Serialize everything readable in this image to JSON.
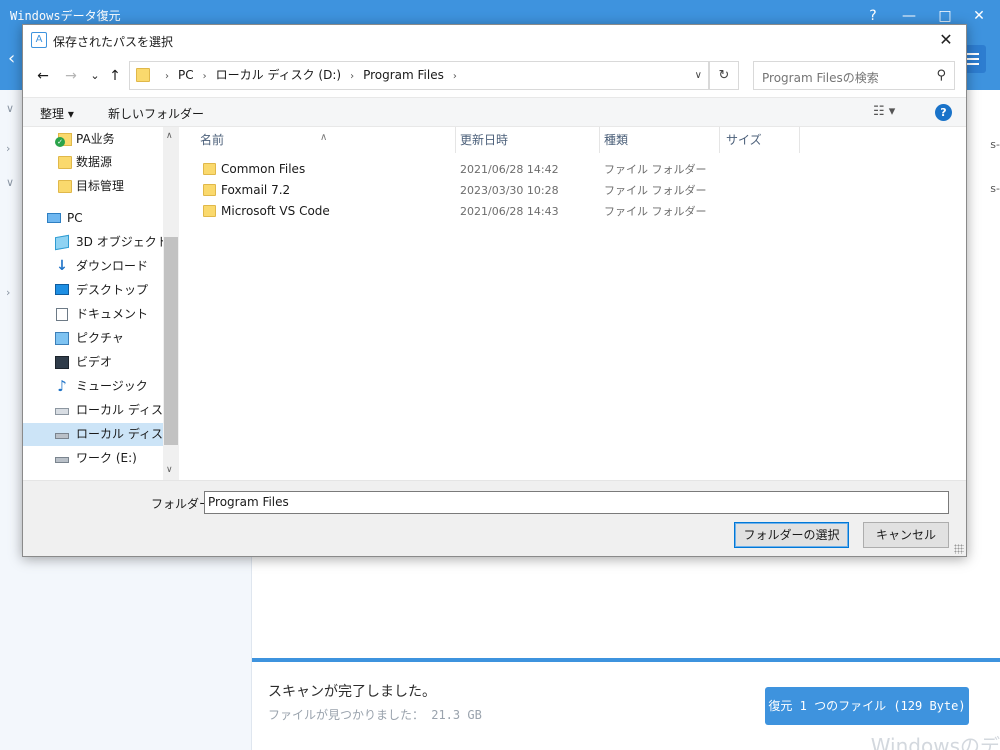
{
  "app": {
    "title": "Windowsデータ復元",
    "controls": {
      "help": "?",
      "minimize": "—",
      "maximize": "□",
      "close": "✕"
    },
    "scan_done": "スキャンが完了しました。",
    "found_text": "ファイルが見つかりました： 21.3 GB",
    "restore_button": "復元 1 つのファイル (129 Byte)",
    "watermark": "Windowsのデ",
    "accent_color": "#3e93de"
  },
  "dialog": {
    "title": "保存されたパスを選択",
    "close": "✕",
    "nav": {
      "back": "←",
      "forward": "→",
      "recent": "⌄",
      "up": "↑"
    },
    "breadcrumbs": [
      "PC",
      "ローカル ディスク (D:)",
      "Program Files"
    ],
    "refresh": "↻",
    "search_placeholder": "Program Filesの検索",
    "toolbar": {
      "organize": "整理 ▾",
      "new_folder": "新しいフォルダー",
      "view": "☷ ▾",
      "help": "?"
    },
    "sidebar": [
      {
        "label": "PA业务",
        "icon": "pa-folder-icon"
      },
      {
        "label": "数据源",
        "icon": "folder-icon"
      },
      {
        "label": "目标管理",
        "icon": "folder-icon"
      },
      {
        "label": "PC",
        "icon": "pc-icon"
      },
      {
        "label": "3D オブジェクト",
        "icon": "3d-objects-icon"
      },
      {
        "label": "ダウンロード",
        "icon": "download-icon"
      },
      {
        "label": "デスクトップ",
        "icon": "desktop-icon"
      },
      {
        "label": "ドキュメント",
        "icon": "document-icon"
      },
      {
        "label": "ピクチャ",
        "icon": "pictures-icon"
      },
      {
        "label": "ビデオ",
        "icon": "video-icon"
      },
      {
        "label": "ミュージック",
        "icon": "music-icon"
      },
      {
        "label": "ローカル ディスク (C",
        "icon": "drive-c-icon"
      },
      {
        "label": "ローカル ディスク (D",
        "icon": "drive-d-icon",
        "selected": true
      },
      {
        "label": "ワーク (E:)",
        "icon": "drive-e-icon"
      }
    ],
    "columns": {
      "name": "名前",
      "modified": "更新日時",
      "type": "種類",
      "size": "サイズ"
    },
    "files": [
      {
        "name": "Common Files",
        "modified": "2021/06/28 14:42",
        "type": "ファイル フォルダー"
      },
      {
        "name": "Foxmail 7.2",
        "modified": "2023/03/30 10:28",
        "type": "ファイル フォルダー"
      },
      {
        "name": "Microsoft VS Code",
        "modified": "2021/06/28 14:43",
        "type": "ファイル フォルダー"
      }
    ],
    "folder_label": "フォルダー:",
    "folder_value": "Program Files",
    "select_button": "フォルダーの選択",
    "cancel_button": "キャンセル"
  }
}
